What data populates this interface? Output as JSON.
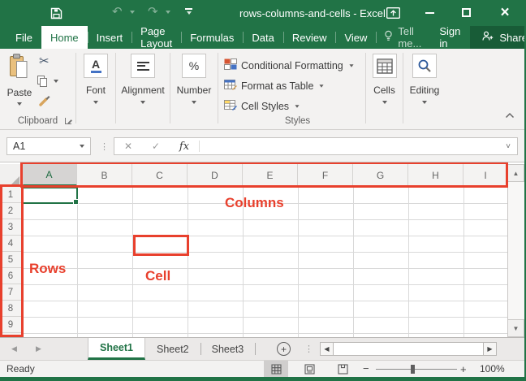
{
  "titlebar": {
    "title": "rows-columns-and-cells - Excel",
    "undo_icon": "↶",
    "redo_icon": "↷",
    "close_icon": "×"
  },
  "menu": {
    "tabs": [
      "File",
      "Home",
      "Insert",
      "Page Layout",
      "Formulas",
      "Data",
      "Review",
      "View"
    ],
    "active_tab": "Home",
    "tell_me": "Tell me...",
    "sign_in": "Sign in",
    "share": "Share"
  },
  "ribbon": {
    "clipboard": {
      "paste_label": "Paste",
      "cut_icon": "✂",
      "group_label": "Clipboard"
    },
    "font": {
      "label": "Font",
      "icon_letter": "A"
    },
    "alignment": {
      "label": "Alignment"
    },
    "number": {
      "label": "Number",
      "icon_glyph": "%"
    },
    "styles": {
      "items": [
        "Conditional Formatting",
        "Format as Table",
        "Cell Styles"
      ],
      "group_label": "Styles"
    },
    "cells": {
      "label": "Cells"
    },
    "editing": {
      "label": "Editing"
    }
  },
  "formula_bar": {
    "name_box": "A1",
    "cancel_icon": "✕",
    "enter_icon": "✓",
    "fx_label": "fx",
    "dots_icon": "⋮",
    "expand_icon": "˅"
  },
  "grid": {
    "selected_cell": "A1",
    "columns": [
      "A",
      "B",
      "C",
      "D",
      "E",
      "F",
      "G",
      "H",
      "I"
    ],
    "rows": [
      "1",
      "2",
      "3",
      "4",
      "5",
      "6",
      "7",
      "8",
      "9"
    ],
    "scroll_up_icon": "▲",
    "scroll_down_icon": "▼"
  },
  "annotations": {
    "columns_label": "Columns",
    "rows_label": "Rows",
    "cell_label": "Cell",
    "highlighted_cell": "C4",
    "highlight_color": "#e8402d"
  },
  "sheet_bar": {
    "sheets": [
      "Sheet1",
      "Sheet2",
      "Sheet3"
    ],
    "active_sheet": "Sheet1",
    "new_sheet_icon": "+",
    "nav_left_icon": "◀",
    "nav_right_icon": "▶",
    "dots_icon": "⋮"
  },
  "status_bar": {
    "status": "Ready",
    "zoom_out": "−",
    "zoom_in": "+",
    "zoom_level": "100%"
  },
  "colors": {
    "excel_green": "#217346",
    "share_green": "#185c37",
    "annotation_red": "#e8402d"
  }
}
